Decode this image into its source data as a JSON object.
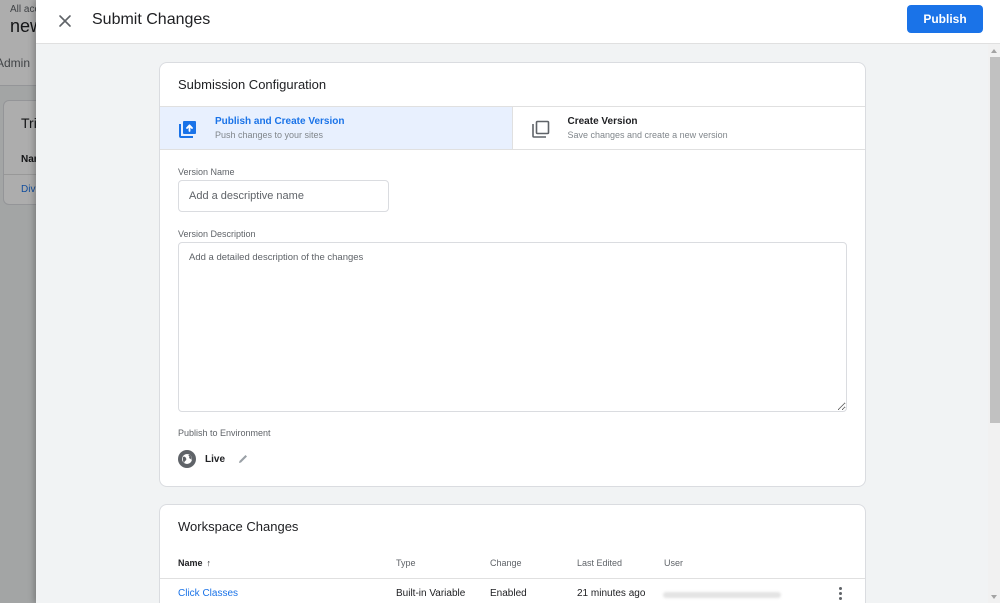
{
  "background": {
    "breadcrumb": "All accounts",
    "container_name": "new",
    "tab_label": "Admin",
    "card_title": "Triggers",
    "card_column": "Name",
    "card_link": "Div"
  },
  "sheet": {
    "title": "Submit Changes",
    "publish_label": "Publish",
    "close_icon": "close-icon"
  },
  "submission": {
    "title": "Submission Configuration",
    "options": [
      {
        "label": "Publish and Create Version",
        "sub": "Push changes to your sites",
        "icon": "publish-upload-icon",
        "selected": true
      },
      {
        "label": "Create Version",
        "sub": "Save changes and create a new version",
        "icon": "copy-version-icon",
        "selected": false
      }
    ],
    "version_name": {
      "label": "Version Name",
      "placeholder": "Add a descriptive name",
      "value": ""
    },
    "version_description": {
      "label": "Version Description",
      "placeholder": "Add a detailed description of the changes",
      "value": ""
    },
    "environment": {
      "label": "Publish to Environment",
      "name": "Live",
      "icon": "globe-icon",
      "edit_icon": "pencil-icon"
    }
  },
  "workspace_changes": {
    "title": "Workspace Changes",
    "columns": [
      {
        "label": "Name",
        "sort": "ascending"
      },
      {
        "label": "Type"
      },
      {
        "label": "Change"
      },
      {
        "label": "Last Edited"
      },
      {
        "label": "User"
      }
    ],
    "sort_arrow": "↑",
    "rows": [
      {
        "name": "Click Classes",
        "type": "Built-in Variable",
        "change": "Enabled",
        "last_edited": "21 minutes ago",
        "user": "(redacted)"
      }
    ]
  },
  "colors": {
    "accent": "#1a73e8",
    "selected_bg": "#e8f0fe",
    "sheet_bg": "#f1f3f4"
  }
}
